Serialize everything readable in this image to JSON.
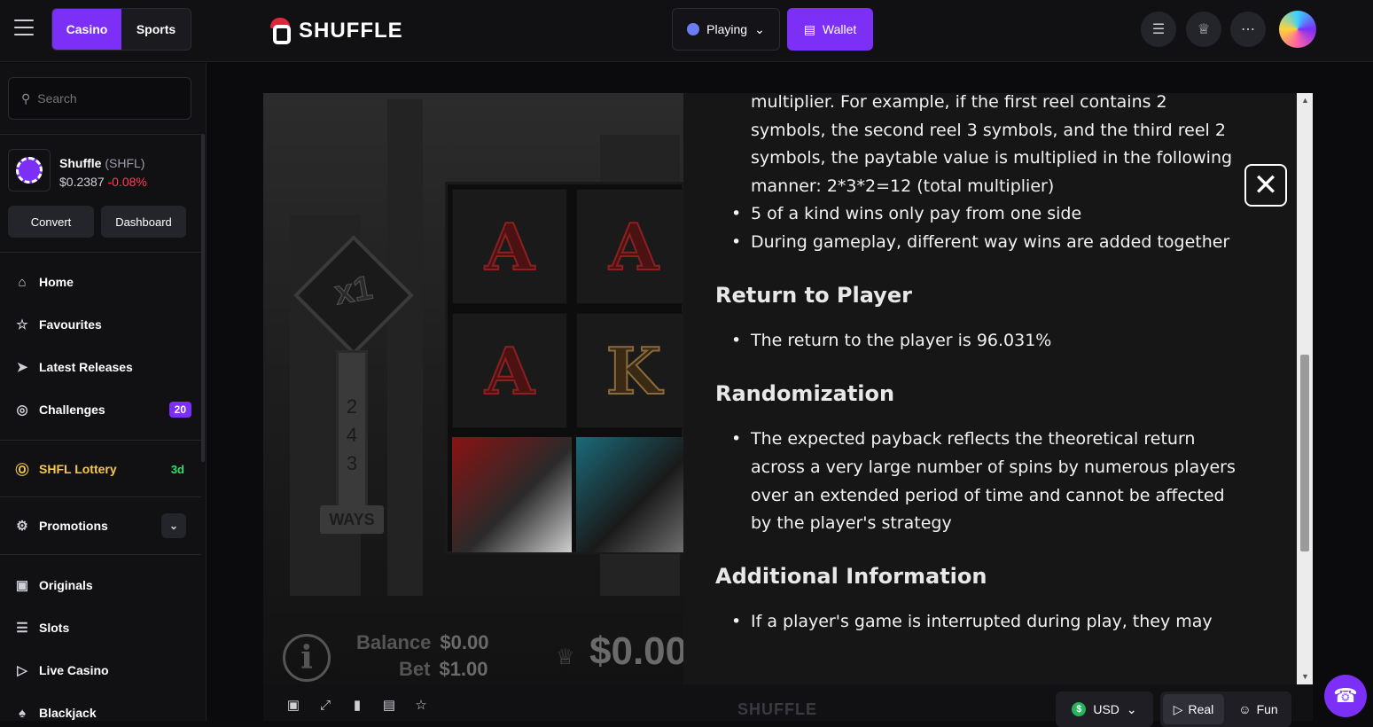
{
  "header": {
    "tabs": [
      {
        "label": "Casino"
      },
      {
        "label": "Sports"
      }
    ],
    "logo_text": "SHUFFLE",
    "playing_label": "Playing",
    "wallet_label": "Wallet"
  },
  "sidebar": {
    "search_placeholder": "Search",
    "token": {
      "name": "Shuffle",
      "ticker": "(SHFL)",
      "price": "$0.2387",
      "change": "-0.08%"
    },
    "convert_label": "Convert",
    "dashboard_label": "Dashboard",
    "nav": [
      {
        "label": "Home",
        "icon": "home-icon"
      },
      {
        "label": "Favourites",
        "icon": "star-icon"
      },
      {
        "label": "Latest Releases",
        "icon": "rocket-icon"
      },
      {
        "label": "Challenges",
        "icon": "target-icon",
        "badge": "20"
      }
    ],
    "lottery": {
      "label": "SHFL Lottery",
      "badge": "3d"
    },
    "promotions_label": "Promotions",
    "games": [
      {
        "label": "Originals",
        "icon": "gamepad-icon"
      },
      {
        "label": "Slots",
        "icon": "coins-icon"
      },
      {
        "label": "Live Casino",
        "icon": "play-circle-icon"
      },
      {
        "label": "Blackjack",
        "icon": "cards-icon"
      }
    ]
  },
  "game": {
    "multiplier": "x1",
    "ways_numbers": [
      "2",
      "4",
      "3"
    ],
    "ways_label": "WAYS",
    "reel_letters": [
      "A",
      "A",
      "A",
      "K"
    ],
    "balance_label": "Balance",
    "balance_value": "$0.00",
    "bet_label": "Bet",
    "bet_value": "$1.00",
    "win_value": "$0.00"
  },
  "rules": {
    "intro_text": "multiplier. For example, if the first reel contains 2 symbols, the second reel 3 symbols, and the third reel 2 symbols, the paytable value is multiplied in the following manner: 2*3*2=12 (total multiplier)",
    "bullets_1": [
      "5 of a kind wins only pay from one side",
      "During gameplay, different way wins are added together"
    ],
    "rtp_heading": "Return to Player",
    "rtp_text": "The return to the player is 96.031%",
    "random_heading": "Randomization",
    "random_text": "The expected payback reflects the theoretical return across a very large number of spins by numerous players over an extended period of time and cannot be affected by the player's strategy",
    "additional_heading": "Additional Information",
    "additional_text": "If a player's game is interrupted during play, they may"
  },
  "footer": {
    "watermark": "SHUFFLE",
    "currency": "USD",
    "real_label": "Real",
    "fun_label": "Fun"
  },
  "colors": {
    "accent": "#7b2ff7",
    "negative": "#ff3d55",
    "lottery": "#f7c948",
    "lottery_badge": "#2ee06a"
  }
}
